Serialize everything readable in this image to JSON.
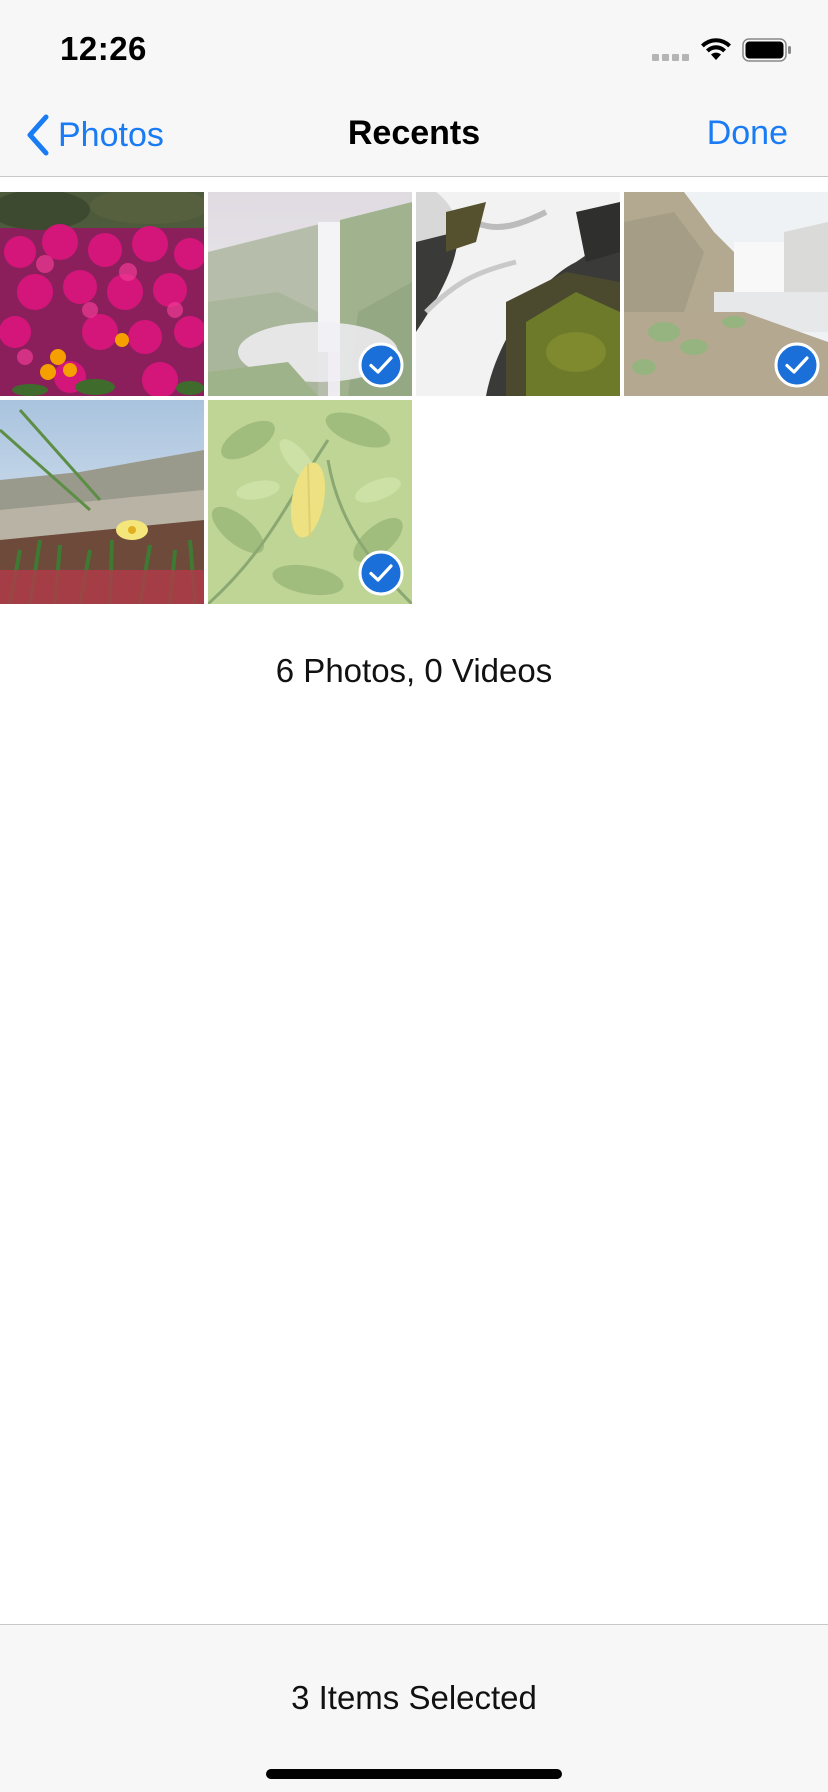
{
  "status_bar": {
    "time": "12:26",
    "icons": [
      "signal-icon",
      "wifi-icon",
      "battery-icon"
    ]
  },
  "nav": {
    "back_label": "Photos",
    "title": "Recents",
    "done_label": "Done"
  },
  "photos": [
    {
      "subject": "pink-flowers",
      "selected": false
    },
    {
      "subject": "misty-waterfall",
      "selected": true
    },
    {
      "subject": "waterfall-rocks",
      "selected": false
    },
    {
      "subject": "waterfall-cliff",
      "selected": true
    },
    {
      "subject": "dune-flower",
      "selected": false
    },
    {
      "subject": "green-leaves",
      "selected": true
    }
  ],
  "summary": "6 Photos, 0 Videos",
  "toolbar": {
    "selected_text": "3 Items Selected"
  },
  "colors": {
    "accent": "#1a7cf5",
    "bar_background": "#f7f7f7",
    "check_fill": "#1a6fd8"
  }
}
